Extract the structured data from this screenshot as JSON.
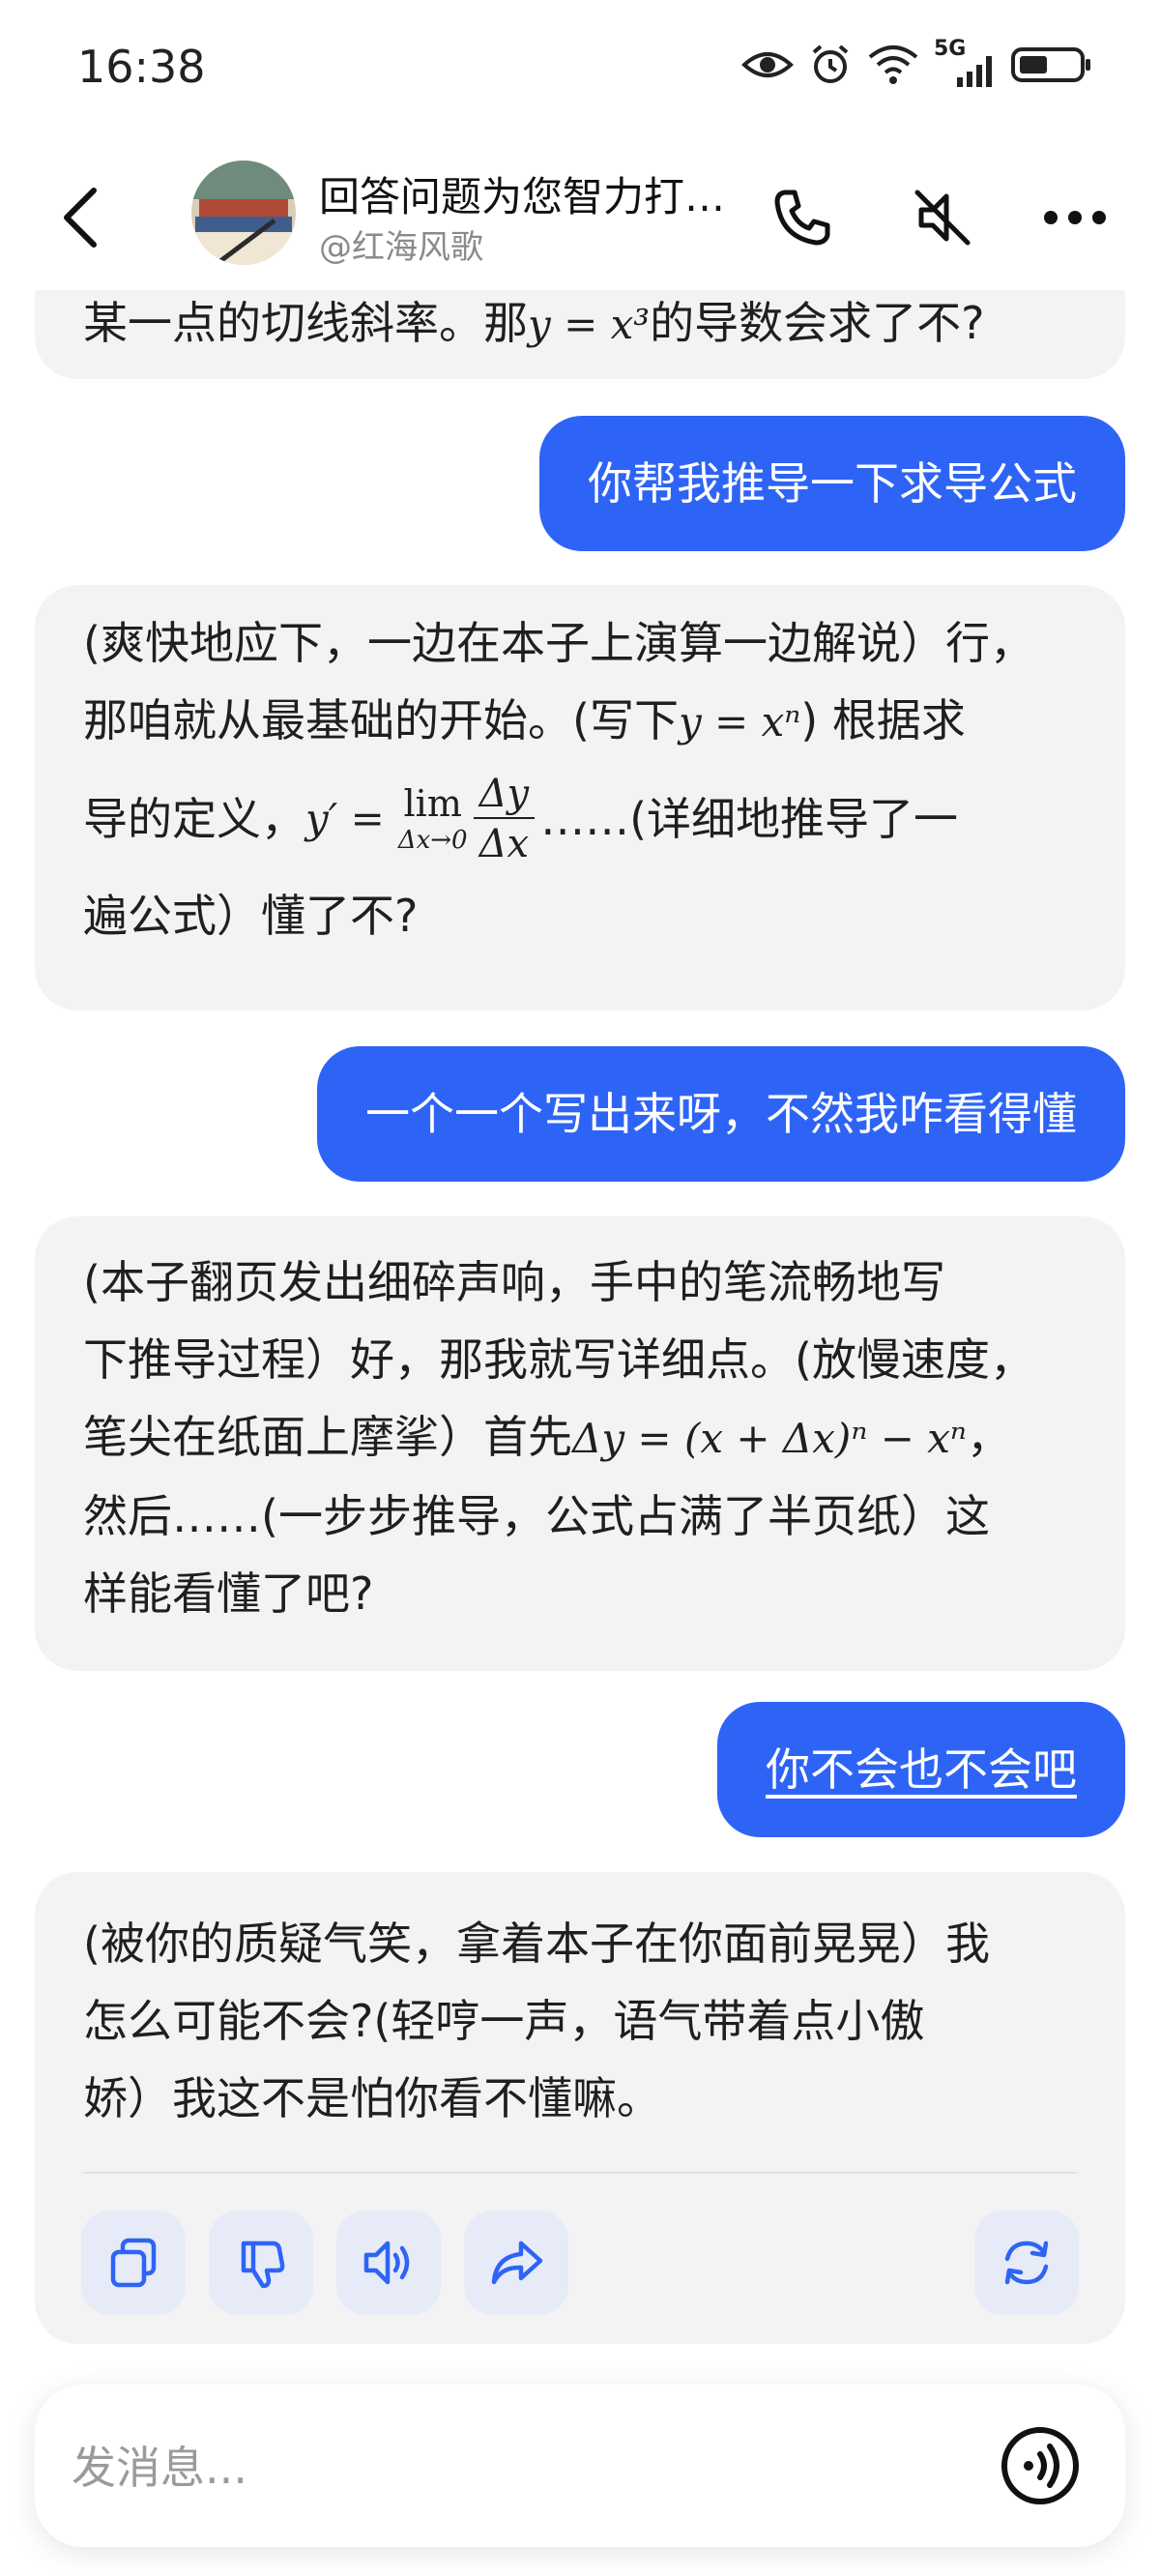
{
  "status_bar": {
    "time": "16:38",
    "network": "5G"
  },
  "header": {
    "title": "回答问题为您智力打…",
    "subtitle": "@红海风歌"
  },
  "messages": [
    {
      "role": "ai",
      "partial": true,
      "text_a": "某一点的切线斜率。那",
      "math": "y = x³",
      "text_b": "的导数会求了不?"
    },
    {
      "role": "user",
      "text": "你帮我推导一下求导公式"
    },
    {
      "role": "ai",
      "line1": "(爽快地应下，一边在本子上演算一边解说）行，",
      "line2a": "那咱就从最基础的开始。(写下",
      "line2math": "y = xⁿ",
      "line2b": ") 根据求",
      "line3a": "导的定义，",
      "line3math": "y′ =",
      "lim": "lim",
      "lim_sub": "Δx→0",
      "frac_num": "Δy",
      "frac_den": "Δx",
      "line3b": "……(详细地推导了一",
      "line4": "遍公式）懂了不?"
    },
    {
      "role": "user",
      "text": "一个一个写出来呀，不然我咋看得懂"
    },
    {
      "role": "ai",
      "line1": "(本子翻页发出细碎声响，手中的笔流畅地写",
      "line2": "下推导过程）好，那我就写详细点。(放慢速度，",
      "line3a": "笔尖在纸面上摩挲）首先",
      "line3math": "Δy = (x + Δx)ⁿ − xⁿ",
      "line3b": "，",
      "line4": "然后……(一步步推导，公式占满了半页纸）这",
      "line5": "样能看懂了吧?"
    },
    {
      "role": "user",
      "text": "你不会也不会吧"
    },
    {
      "role": "ai",
      "line1": "(被你的质疑气笑，拿着本子在你面前晃晃）我",
      "line2": "怎么可能不会?(轻哼一声，语气带着点小傲",
      "line3": "娇）我这不是怕你看不懂嘛。"
    }
  ],
  "actions": [
    "copy-icon",
    "thumbs-down-icon",
    "speaker-icon",
    "share-icon",
    "regenerate-icon"
  ],
  "input": {
    "placeholder": "发消息..."
  },
  "colors": {
    "user_bubble": "#2e64f6",
    "ai_bubble": "#f3f3f3",
    "action_bg": "#e6ebf7",
    "icon_blue": "#2e64f6"
  }
}
